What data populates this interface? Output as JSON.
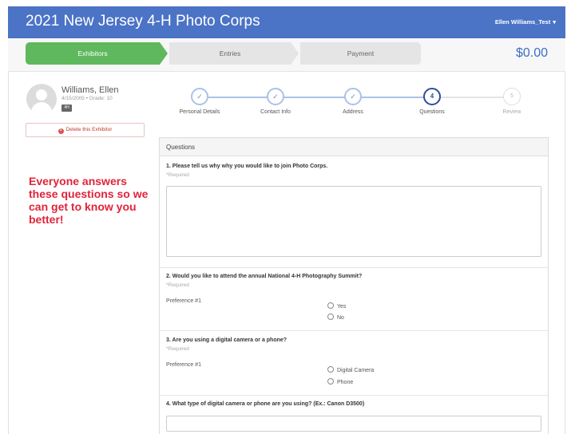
{
  "header": {
    "app_title": "2021 New Jersey 4-H Photo Corps",
    "user_name": "Ellen Williams_Test",
    "user_caret": "▾",
    "brand_color": "#4b73c6"
  },
  "checkout_steps": {
    "items": [
      {
        "label": "Exhibitors",
        "state": "active"
      },
      {
        "label": "Entries",
        "state": "pending"
      },
      {
        "label": "Payment",
        "state": "pending"
      }
    ],
    "total": "$0.00",
    "active_color": "#5fb85d"
  },
  "exhibitor": {
    "name": "Williams, Ellen",
    "meta": "4/15/2005 • Grade: 10",
    "badge": "4H",
    "delete_label": "Delete this Exhibitor",
    "avatar_icon": "user-silhouette-icon"
  },
  "callout": {
    "text": "Everyone answers these questions so we can get to know you better!",
    "color": "#e0243a"
  },
  "wizard": {
    "steps": [
      {
        "label": "Personal Details",
        "marker": "✓",
        "state": "done"
      },
      {
        "label": "Contact Info",
        "marker": "✓",
        "state": "done"
      },
      {
        "label": "Address",
        "marker": "✓",
        "state": "done"
      },
      {
        "label": "Questions",
        "marker": "4",
        "state": "current"
      },
      {
        "label": "Review",
        "marker": "5",
        "state": "future"
      }
    ]
  },
  "questions_panel": {
    "title": "Questions",
    "required_text": "*Required",
    "q1": {
      "text": "1. Please tell us why why you would like to join Photo Corps.",
      "answer": ""
    },
    "q2": {
      "text": "2. Would you like to attend the annual National 4-H Photography Summit?",
      "preference_label": "Preference #1",
      "options": [
        "Yes",
        "No"
      ]
    },
    "q3": {
      "text": "3. Are you using a digital camera or a phone?",
      "preference_label": "Preference #1",
      "options": [
        "Digital Camera",
        "Phone"
      ]
    },
    "q4": {
      "text": "4. What type of digital camera or phone are you using? (Ex.: Canon D3500)",
      "answer": ""
    }
  }
}
